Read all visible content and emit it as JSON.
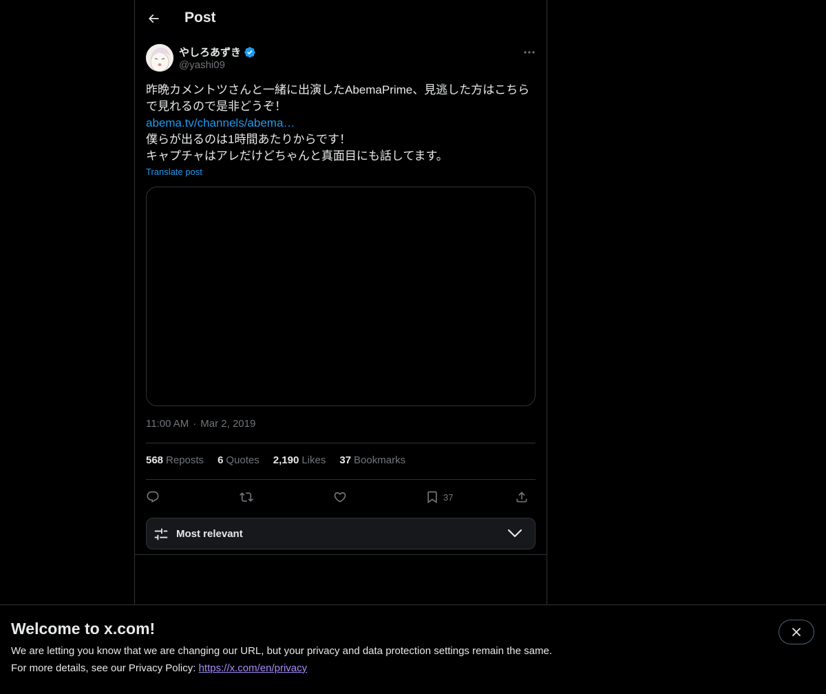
{
  "header": {
    "title": "Post"
  },
  "author": {
    "name": "やしろあずき",
    "handle": "@yashi09"
  },
  "post": {
    "line1": "昨晩カメントツさんと一緒に出演したAbemaPrime、見逃した方はこちら",
    "line2": "で見れるので是非どうぞ！",
    "link": "abema.tv/channels/abema…",
    "line3": "僕らが出るのは1時間あたりからです！",
    "line4": "キャプチャはアレだけどちゃんと真面目にも話してます。",
    "translate": "Translate post"
  },
  "meta": {
    "time": "11:00 AM",
    "separator": "·",
    "date": "Mar 2, 2019"
  },
  "stats": [
    {
      "num": "568",
      "label": "Reposts"
    },
    {
      "num": "6",
      "label": "Quotes"
    },
    {
      "num": "2,190",
      "label": "Likes"
    },
    {
      "num": "37",
      "label": "Bookmarks"
    }
  ],
  "actions": {
    "bookmark_count": "37"
  },
  "sort": {
    "label": "Most relevant"
  },
  "banner": {
    "title": "Welcome to x.com!",
    "text1": "We are letting you know that we are changing our URL, but your privacy and data protection settings remain the same.",
    "text2_prefix": "For more details, see our Privacy Policy: ",
    "link": "https://x.com/en/privacy"
  },
  "colors": {
    "accent": "#1d9bf0",
    "background": "#000000",
    "border": "#2f3336",
    "muted": "#71767b"
  },
  "icons": [
    "back-arrow-icon",
    "verified-badge-icon",
    "more-icon",
    "reply-icon",
    "repost-icon",
    "like-icon",
    "bookmark-icon",
    "share-icon",
    "filter-icon",
    "chevron-down-icon",
    "close-icon"
  ]
}
